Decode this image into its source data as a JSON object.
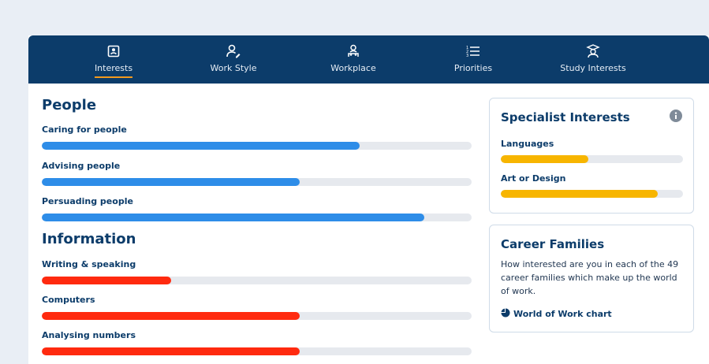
{
  "tabs": [
    {
      "label": "Interests",
      "icon": "profile-card-icon",
      "active": true
    },
    {
      "label": "Work Style",
      "icon": "person-edit-icon",
      "active": false
    },
    {
      "label": "Workplace",
      "icon": "people-group-icon",
      "active": false
    },
    {
      "label": "Priorities",
      "icon": "numbered-list-icon",
      "active": false
    },
    {
      "label": "Study Interests",
      "icon": "graduate-icon",
      "active": false
    }
  ],
  "sections": [
    {
      "title": "People",
      "color": "#2e8de8",
      "items": [
        {
          "label": "Caring for people",
          "percent": 74
        },
        {
          "label": "Advising people",
          "percent": 60
        },
        {
          "label": "Persuading people",
          "percent": 89
        }
      ]
    },
    {
      "title": "Information",
      "color": "#ff2a0f",
      "items": [
        {
          "label": "Writing & speaking",
          "percent": 30
        },
        {
          "label": "Computers",
          "percent": 60
        },
        {
          "label": "Analysing numbers",
          "percent": 60
        }
      ]
    }
  ],
  "specialist": {
    "title": "Specialist Interests",
    "info_icon": "info-circle-icon",
    "items": [
      {
        "label": "Languages",
        "percent": 48
      },
      {
        "label": "Art or Design",
        "percent": 86
      }
    ],
    "bar_color": "#f7b500"
  },
  "career": {
    "title": "Career Families",
    "description": "How interested are you in each of the 49 career families which make up the world of work.",
    "link_label": "World of Work chart",
    "link_icon": "pie-chart-icon"
  }
}
